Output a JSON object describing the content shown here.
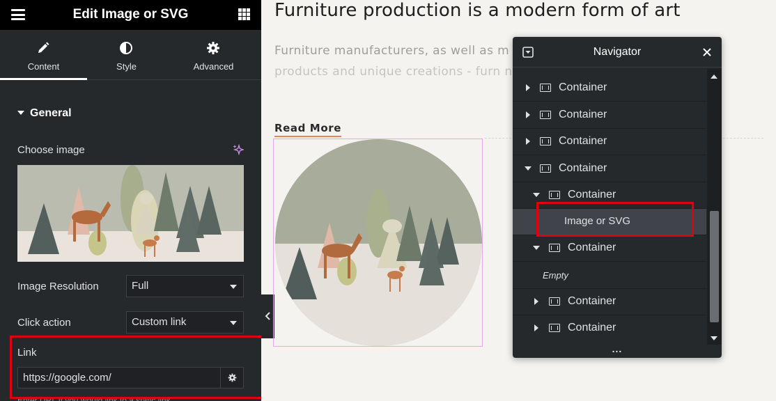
{
  "panel": {
    "title": "Edit Image or SVG",
    "tabs": [
      {
        "label": "Content",
        "icon": "pencil-icon",
        "active": true
      },
      {
        "label": "Style",
        "icon": "half-circle-icon",
        "active": false
      },
      {
        "label": "Advanced",
        "icon": "gear-icon",
        "active": false
      }
    ],
    "section_title": "General",
    "choose_image_label": "Choose image",
    "image_resolution_label": "Image Resolution",
    "image_resolution_value": "Full",
    "click_action_label": "Click action",
    "click_action_value": "Custom link",
    "link_label": "Link",
    "link_value": "https://google.com/",
    "hint_text": "Enter URL if you would link to a static link"
  },
  "page": {
    "heading": "Furniture production is a modern form of art",
    "paragraph_line1": "Furniture manufacturers, as well as m                                    ds, are fu",
    "paragraph_line2": "products and unique creations - furn                                     n, which",
    "read_more": "Read More"
  },
  "navigator": {
    "title": "Navigator",
    "items": [
      {
        "label": "Container",
        "level": 0,
        "state": "collapsed"
      },
      {
        "label": "Container",
        "level": 0,
        "state": "collapsed"
      },
      {
        "label": "Container",
        "level": 0,
        "state": "collapsed"
      },
      {
        "label": "Container",
        "level": 0,
        "state": "expanded"
      },
      {
        "label": "Container",
        "level": 1,
        "state": "expanded"
      },
      {
        "label": "Image or SVG",
        "level": 2,
        "state": "selected"
      },
      {
        "label": "Container",
        "level": 1,
        "state": "expanded"
      },
      {
        "label": "Empty",
        "level": 2,
        "state": "empty"
      },
      {
        "label": "Container",
        "level": 1,
        "state": "collapsed"
      },
      {
        "label": "Container",
        "level": 1,
        "state": "collapsed"
      }
    ],
    "footer": "..."
  },
  "colors": {
    "panel_bg": "#26292c",
    "header_bg": "#000000",
    "highlight_red": "#e0000f",
    "widget_outline": "#e6a6ee",
    "read_more_underline": "#e08a4f"
  }
}
